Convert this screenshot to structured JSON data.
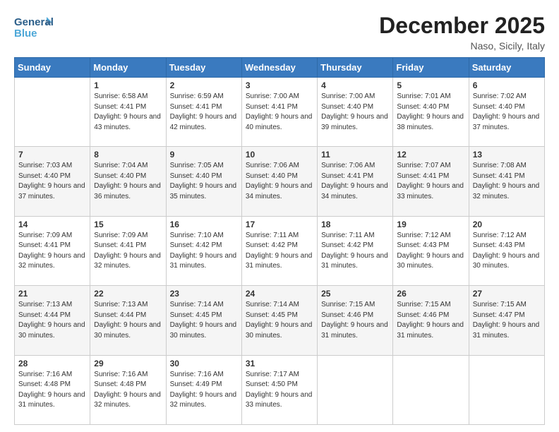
{
  "header": {
    "logo_line1": "General",
    "logo_line2": "Blue",
    "month": "December 2025",
    "location": "Naso, Sicily, Italy"
  },
  "weekdays": [
    "Sunday",
    "Monday",
    "Tuesday",
    "Wednesday",
    "Thursday",
    "Friday",
    "Saturday"
  ],
  "weeks": [
    [
      {
        "day": "",
        "sunrise": "",
        "sunset": "",
        "daylight": ""
      },
      {
        "day": "1",
        "sunrise": "Sunrise: 6:58 AM",
        "sunset": "Sunset: 4:41 PM",
        "daylight": "Daylight: 9 hours and 43 minutes."
      },
      {
        "day": "2",
        "sunrise": "Sunrise: 6:59 AM",
        "sunset": "Sunset: 4:41 PM",
        "daylight": "Daylight: 9 hours and 42 minutes."
      },
      {
        "day": "3",
        "sunrise": "Sunrise: 7:00 AM",
        "sunset": "Sunset: 4:41 PM",
        "daylight": "Daylight: 9 hours and 40 minutes."
      },
      {
        "day": "4",
        "sunrise": "Sunrise: 7:00 AM",
        "sunset": "Sunset: 4:40 PM",
        "daylight": "Daylight: 9 hours and 39 minutes."
      },
      {
        "day": "5",
        "sunrise": "Sunrise: 7:01 AM",
        "sunset": "Sunset: 4:40 PM",
        "daylight": "Daylight: 9 hours and 38 minutes."
      },
      {
        "day": "6",
        "sunrise": "Sunrise: 7:02 AM",
        "sunset": "Sunset: 4:40 PM",
        "daylight": "Daylight: 9 hours and 37 minutes."
      }
    ],
    [
      {
        "day": "7",
        "sunrise": "Sunrise: 7:03 AM",
        "sunset": "Sunset: 4:40 PM",
        "daylight": "Daylight: 9 hours and 37 minutes."
      },
      {
        "day": "8",
        "sunrise": "Sunrise: 7:04 AM",
        "sunset": "Sunset: 4:40 PM",
        "daylight": "Daylight: 9 hours and 36 minutes."
      },
      {
        "day": "9",
        "sunrise": "Sunrise: 7:05 AM",
        "sunset": "Sunset: 4:40 PM",
        "daylight": "Daylight: 9 hours and 35 minutes."
      },
      {
        "day": "10",
        "sunrise": "Sunrise: 7:06 AM",
        "sunset": "Sunset: 4:40 PM",
        "daylight": "Daylight: 9 hours and 34 minutes."
      },
      {
        "day": "11",
        "sunrise": "Sunrise: 7:06 AM",
        "sunset": "Sunset: 4:41 PM",
        "daylight": "Daylight: 9 hours and 34 minutes."
      },
      {
        "day": "12",
        "sunrise": "Sunrise: 7:07 AM",
        "sunset": "Sunset: 4:41 PM",
        "daylight": "Daylight: 9 hours and 33 minutes."
      },
      {
        "day": "13",
        "sunrise": "Sunrise: 7:08 AM",
        "sunset": "Sunset: 4:41 PM",
        "daylight": "Daylight: 9 hours and 32 minutes."
      }
    ],
    [
      {
        "day": "14",
        "sunrise": "Sunrise: 7:09 AM",
        "sunset": "Sunset: 4:41 PM",
        "daylight": "Daylight: 9 hours and 32 minutes."
      },
      {
        "day": "15",
        "sunrise": "Sunrise: 7:09 AM",
        "sunset": "Sunset: 4:41 PM",
        "daylight": "Daylight: 9 hours and 32 minutes."
      },
      {
        "day": "16",
        "sunrise": "Sunrise: 7:10 AM",
        "sunset": "Sunset: 4:42 PM",
        "daylight": "Daylight: 9 hours and 31 minutes."
      },
      {
        "day": "17",
        "sunrise": "Sunrise: 7:11 AM",
        "sunset": "Sunset: 4:42 PM",
        "daylight": "Daylight: 9 hours and 31 minutes."
      },
      {
        "day": "18",
        "sunrise": "Sunrise: 7:11 AM",
        "sunset": "Sunset: 4:42 PM",
        "daylight": "Daylight: 9 hours and 31 minutes."
      },
      {
        "day": "19",
        "sunrise": "Sunrise: 7:12 AM",
        "sunset": "Sunset: 4:43 PM",
        "daylight": "Daylight: 9 hours and 30 minutes."
      },
      {
        "day": "20",
        "sunrise": "Sunrise: 7:12 AM",
        "sunset": "Sunset: 4:43 PM",
        "daylight": "Daylight: 9 hours and 30 minutes."
      }
    ],
    [
      {
        "day": "21",
        "sunrise": "Sunrise: 7:13 AM",
        "sunset": "Sunset: 4:44 PM",
        "daylight": "Daylight: 9 hours and 30 minutes."
      },
      {
        "day": "22",
        "sunrise": "Sunrise: 7:13 AM",
        "sunset": "Sunset: 4:44 PM",
        "daylight": "Daylight: 9 hours and 30 minutes."
      },
      {
        "day": "23",
        "sunrise": "Sunrise: 7:14 AM",
        "sunset": "Sunset: 4:45 PM",
        "daylight": "Daylight: 9 hours and 30 minutes."
      },
      {
        "day": "24",
        "sunrise": "Sunrise: 7:14 AM",
        "sunset": "Sunset: 4:45 PM",
        "daylight": "Daylight: 9 hours and 30 minutes."
      },
      {
        "day": "25",
        "sunrise": "Sunrise: 7:15 AM",
        "sunset": "Sunset: 4:46 PM",
        "daylight": "Daylight: 9 hours and 31 minutes."
      },
      {
        "day": "26",
        "sunrise": "Sunrise: 7:15 AM",
        "sunset": "Sunset: 4:46 PM",
        "daylight": "Daylight: 9 hours and 31 minutes."
      },
      {
        "day": "27",
        "sunrise": "Sunrise: 7:15 AM",
        "sunset": "Sunset: 4:47 PM",
        "daylight": "Daylight: 9 hours and 31 minutes."
      }
    ],
    [
      {
        "day": "28",
        "sunrise": "Sunrise: 7:16 AM",
        "sunset": "Sunset: 4:48 PM",
        "daylight": "Daylight: 9 hours and 31 minutes."
      },
      {
        "day": "29",
        "sunrise": "Sunrise: 7:16 AM",
        "sunset": "Sunset: 4:48 PM",
        "daylight": "Daylight: 9 hours and 32 minutes."
      },
      {
        "day": "30",
        "sunrise": "Sunrise: 7:16 AM",
        "sunset": "Sunset: 4:49 PM",
        "daylight": "Daylight: 9 hours and 32 minutes."
      },
      {
        "day": "31",
        "sunrise": "Sunrise: 7:17 AM",
        "sunset": "Sunset: 4:50 PM",
        "daylight": "Daylight: 9 hours and 33 minutes."
      },
      {
        "day": "",
        "sunrise": "",
        "sunset": "",
        "daylight": ""
      },
      {
        "day": "",
        "sunrise": "",
        "sunset": "",
        "daylight": ""
      },
      {
        "day": "",
        "sunrise": "",
        "sunset": "",
        "daylight": ""
      }
    ]
  ]
}
